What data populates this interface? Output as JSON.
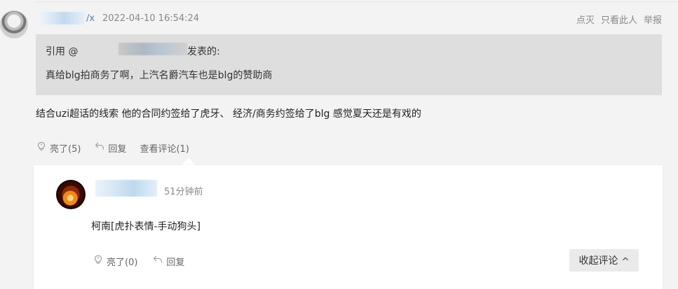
{
  "post": {
    "username_suffix": "/x",
    "timestamp": "2022-04-10 16:54:24",
    "top_actions": [
      "点灭",
      "只看此人",
      "举报"
    ],
    "quote": {
      "prefix": "引用 @",
      "suffix": "发表的:",
      "text": "真给blg拍商务了啊，上汽名爵汽车也是blg的赞助商"
    },
    "body": "结合uzi超话的线索 他的合同约签给了虎牙、 经济/商务约签给了blg 感觉夏天还是有戏的",
    "actions": {
      "like": "亮了(5)",
      "reply": "回复",
      "view_comments": "查看评论(1)"
    }
  },
  "reply": {
    "time": "51分钟前",
    "text": "柯南[虎扑表情-手动狗头]",
    "actions": {
      "like": "亮了(0)",
      "reply": "回复"
    },
    "collapse_label": "收起评论"
  },
  "icons": {
    "like": "lightbulb-icon",
    "reply": "reply-arrow-icon",
    "collapse": "chevron-up-icon"
  }
}
